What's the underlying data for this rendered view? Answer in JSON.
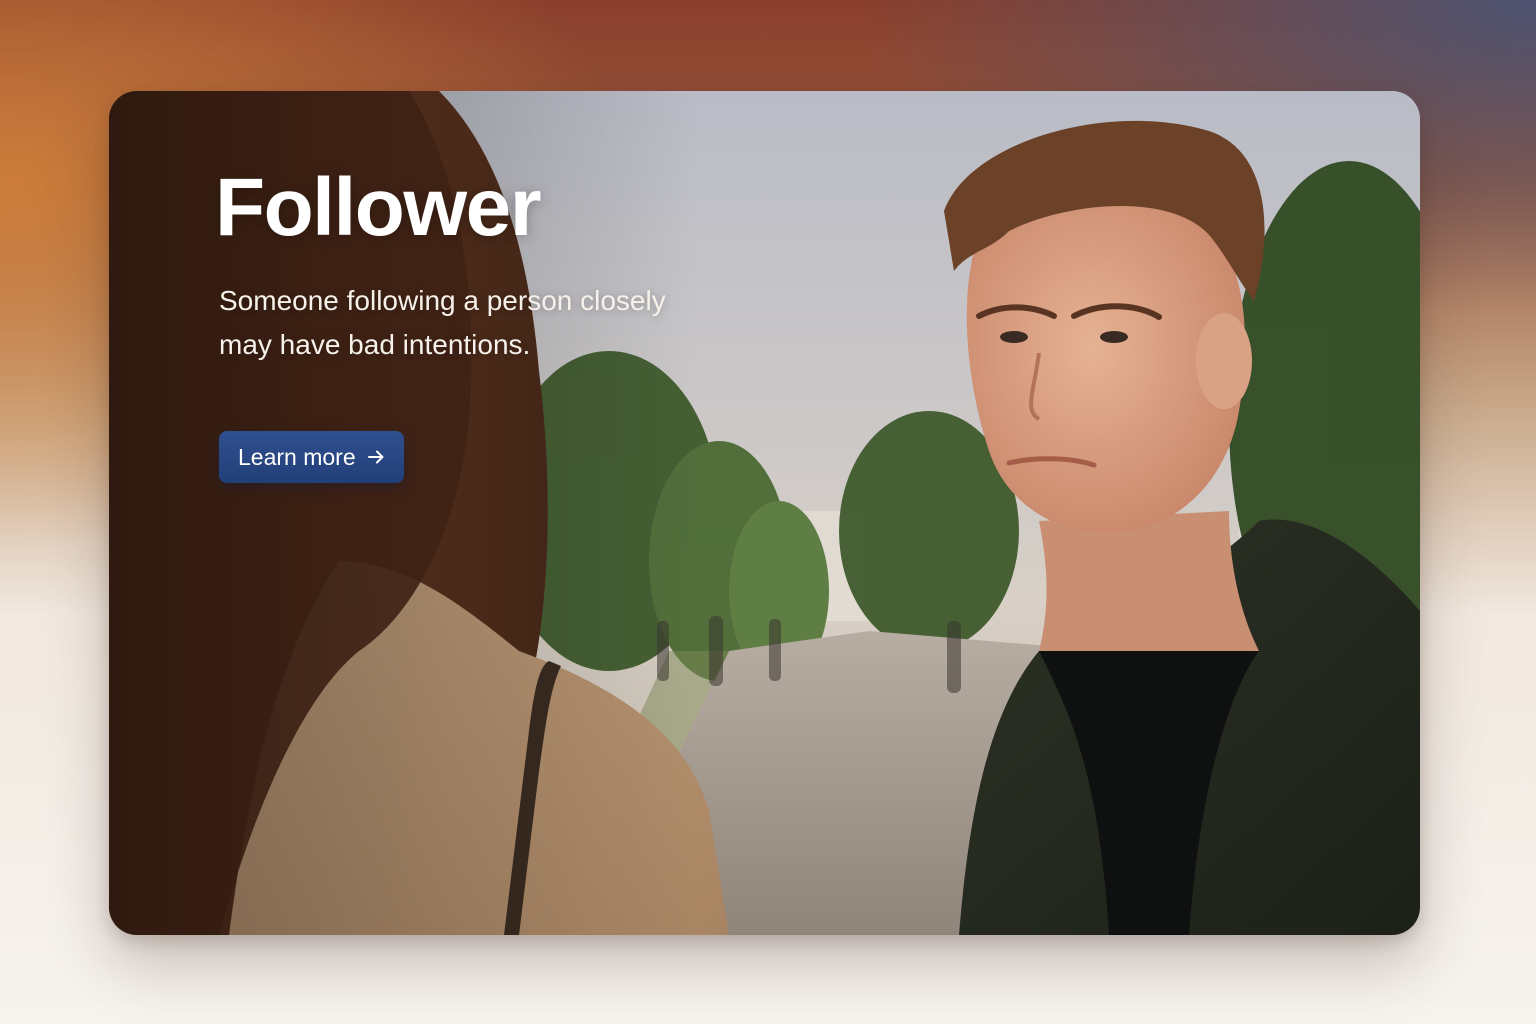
{
  "hero": {
    "title": "Follower",
    "subtitle": "Someone following a person closely may have bad intentions.",
    "cta_label": "Learn more",
    "cta_icon": "arrow-right-icon"
  },
  "colors": {
    "cta_background": "#264583",
    "title_text": "#ffffff"
  }
}
